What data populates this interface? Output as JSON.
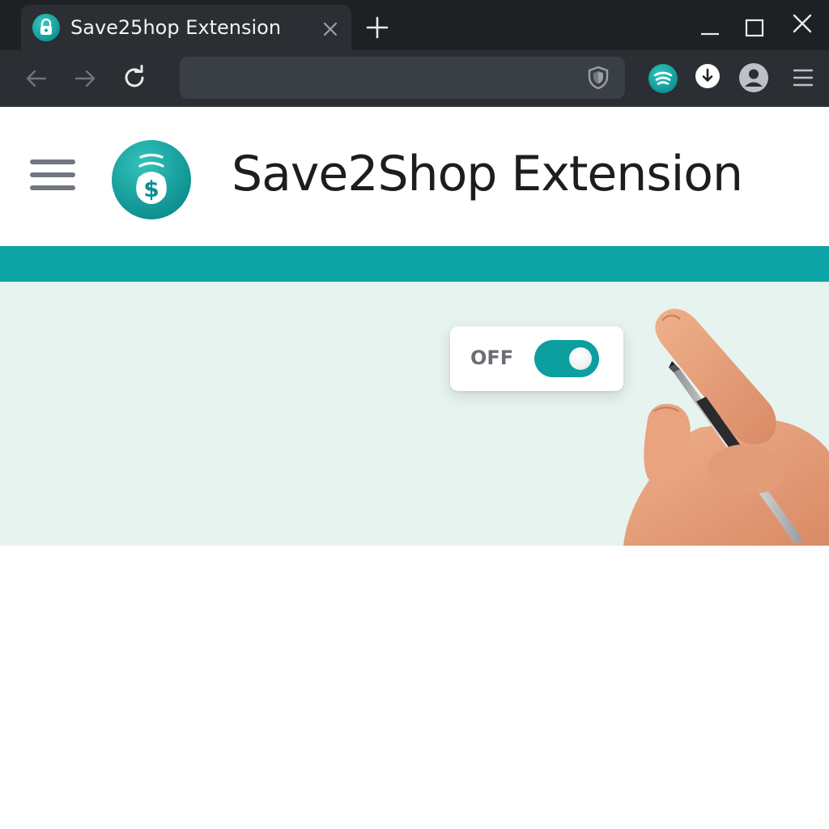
{
  "browser": {
    "tab": {
      "title": "Save25hop Extension",
      "favicon": "padlock-icon"
    },
    "window_controls": [
      "minimize-icon",
      "maximize-icon",
      "close-icon"
    ],
    "toolbar": {
      "address_value": "",
      "icons": [
        "back-arrow-icon",
        "forward-arrow-icon",
        "reload-icon",
        "shield-icon",
        "save2shop-extension-icon",
        "download-icon",
        "profile-icon",
        "menu-icon"
      ]
    }
  },
  "page": {
    "header": {
      "title": "Save2Shop Extension",
      "logo": "money-bag-dollar-icon",
      "menu_icon": "hamburger-icon"
    },
    "toggle": {
      "label": "OFF",
      "state": "on-position"
    },
    "hero_image": "hand-holding-pen"
  },
  "colors": {
    "brand_teal": "#0ea4a6",
    "hero_background": "#e7f3ee",
    "chrome_dark": "#1e2124",
    "chrome_toolbar": "#2b2f33",
    "title_text": "#1b1d1f",
    "toggle_label": "#6b6e75"
  }
}
